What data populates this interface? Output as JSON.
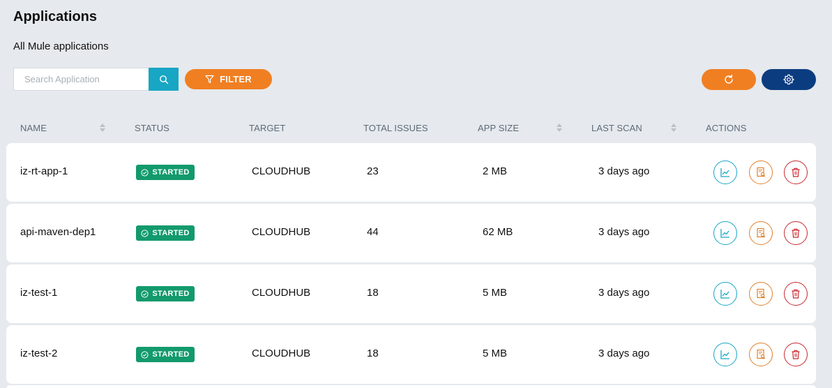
{
  "page": {
    "title": "Applications",
    "subtitle": "All Mule applications"
  },
  "toolbar": {
    "search_placeholder": "Search Application",
    "search_value": "",
    "filter_label": "FILTER"
  },
  "colors": {
    "accent_orange": "#f07f22",
    "navy": "#0c3c80",
    "teal": "#17a6c3",
    "status_green": "#129a6d",
    "danger_red": "#c8282e"
  },
  "table": {
    "columns": {
      "name": "NAME",
      "status": "STATUS",
      "target": "TARGET",
      "total_issues": "TOTAL ISSUES",
      "app_size": "APP SIZE",
      "last_scan": "LAST SCAN",
      "actions": "ACTIONS"
    },
    "sortable_columns": [
      "NAME",
      "APP SIZE",
      "LAST SCAN"
    ],
    "rows": [
      {
        "name": "iz-rt-app-1",
        "status": "STARTED",
        "target": "CLOUDHUB",
        "total_issues": "23",
        "app_size": "2 MB",
        "last_scan": "3 days ago"
      },
      {
        "name": "api-maven-dep1",
        "status": "STARTED",
        "target": "CLOUDHUB",
        "total_issues": "44",
        "app_size": "62 MB",
        "last_scan": "3 days ago"
      },
      {
        "name": "iz-test-1",
        "status": "STARTED",
        "target": "CLOUDHUB",
        "total_issues": "18",
        "app_size": "5 MB",
        "last_scan": "3 days ago"
      },
      {
        "name": "iz-test-2",
        "status": "STARTED",
        "target": "CLOUDHUB",
        "total_issues": "18",
        "app_size": "5 MB",
        "last_scan": "3 days ago"
      }
    ],
    "row_actions": [
      "chart-icon",
      "report-search-icon",
      "trash-icon"
    ]
  }
}
